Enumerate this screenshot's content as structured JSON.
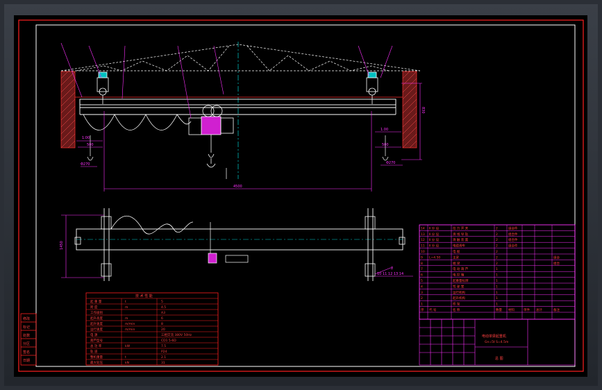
{
  "drawing": {
    "dimensions": {
      "span": "4500",
      "left_hang": "1.00",
      "right_hang": "1.00",
      "left_gap": "500",
      "right_gap": "500",
      "left_height": "830",
      "right_height": "830",
      "left_wheel": "Φ270",
      "top_view_width": "1450"
    },
    "callouts": {
      "left": "2",
      "right": "2",
      "plan_note": "10 11 12 13 14"
    },
    "bom_rows": [
      {
        "no": "14",
        "code": "Ⅱ 分 设",
        "name": "拉 力 开 关",
        "qty": "2",
        "mat": "组合件",
        "note": ""
      },
      {
        "no": "13",
        "code": "Ⅱ 分 设",
        "name": "滑 线 导 轨",
        "qty": "2",
        "mat": "组合件",
        "note": ""
      },
      {
        "no": "12",
        "code": "Ⅱ 分 设",
        "name": "滑 触 装 置",
        "qty": "2",
        "mat": "组合件",
        "note": ""
      },
      {
        "no": "11",
        "code": "Ⅱ 分 设",
        "name": "电缆滑车",
        "qty": "2",
        "mat": "组合件",
        "note": ""
      },
      {
        "no": "10",
        "code": "",
        "name": "电 缆",
        "qty": "2",
        "mat": "",
        "note": ""
      },
      {
        "no": "9",
        "code": "L=4.50",
        "name": "主梁",
        "qty": "2",
        "mat": "",
        "note": "组合"
      },
      {
        "no": "8",
        "code": "",
        "name": "端 梁",
        "qty": "2",
        "mat": "",
        "note": "组合"
      },
      {
        "no": "7",
        "code": "",
        "name": "电 动 葫 芦",
        "qty": "1",
        "mat": "",
        "note": ""
      },
      {
        "no": "6",
        "code": "",
        "name": "电 控 箱",
        "qty": "1",
        "mat": "",
        "note": ""
      },
      {
        "no": "5",
        "code": "",
        "name": "起重量标牌",
        "qty": "1",
        "mat": "",
        "note": ""
      },
      {
        "no": "4",
        "code": "",
        "name": "驾 驶 室",
        "qty": "1",
        "mat": "",
        "note": ""
      },
      {
        "no": "3",
        "code": "",
        "name": "运行机构",
        "qty": "1",
        "mat": "",
        "note": ""
      },
      {
        "no": "2",
        "code": "",
        "name": "起升机构",
        "qty": "1",
        "mat": "",
        "note": ""
      },
      {
        "no": "1",
        "code": "",
        "name": "桥 架",
        "qty": "1",
        "mat": "",
        "note": ""
      }
    ],
    "bom_header": [
      "序",
      "代 号",
      "名 称",
      "数量",
      "材料",
      "单件",
      "总计",
      "备注"
    ],
    "title_block": {
      "title": "电动单梁起重机",
      "subtitle": "Gn=5t  S=4.5m",
      "sheet": "总 图"
    },
    "spec_table": {
      "title": "技 术 性 能",
      "rows": [
        [
          "起 重 量",
          "t",
          "5"
        ],
        [
          "跨 度",
          "m",
          "4.5"
        ],
        [
          "工作级别",
          "",
          "A3"
        ],
        [
          "起升高度",
          "m",
          "6"
        ],
        [
          "起升速度",
          "m/min",
          "8"
        ],
        [
          "运行速度",
          "m/min",
          "20"
        ],
        [
          "电 源",
          "",
          "三相交流 380V 50Hz"
        ],
        [
          "葫芦型号",
          "",
          "CD1 5-6D"
        ],
        [
          "总 功 率",
          "kW",
          "7.5"
        ],
        [
          "轨 道",
          "",
          "P24"
        ],
        [
          "整机重量",
          "t",
          "2.1"
        ],
        [
          "最大轮压",
          "kN",
          "31"
        ]
      ]
    },
    "revision_labels": [
      "修改",
      "标记",
      "处数",
      "分区",
      "签名",
      "日期"
    ]
  }
}
